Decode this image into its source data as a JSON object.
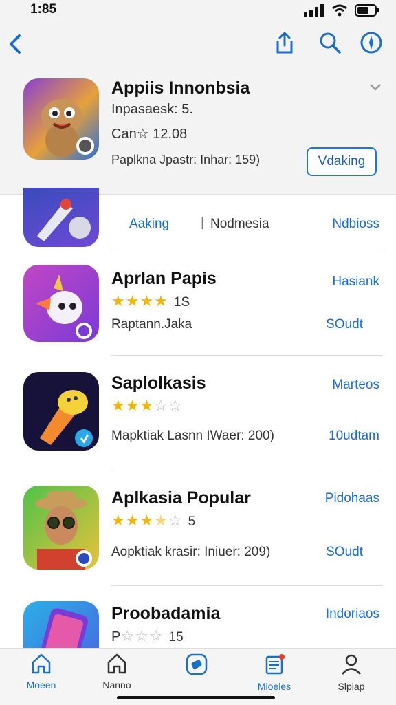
{
  "status_bar": {
    "time": "1:85"
  },
  "header": {
    "title": "Appiis Innonbsia",
    "line1": "Inpasaesk: 5.",
    "line2": "Can☆ 12.08",
    "line3": "Paplkna Jpastr: Inhar: 159)",
    "button": "Vdaking"
  },
  "partial_row": {
    "link_left": "Aaking",
    "separator": "|",
    "text_mid": "Nodmesia",
    "link_right": "Ndbioss"
  },
  "apps": [
    {
      "name": "Aprlan Papis",
      "rating_count": "1S",
      "subtitle": "Raptann.Jaka",
      "link_top": "Hasiank",
      "link_bottom": "SOudt",
      "stars_full": 4,
      "stars_empty": 0
    },
    {
      "name": "Saplolkasis",
      "rating_count": "",
      "subtitle": "Mapktiak Lasnn IWaer: 200)",
      "link_top": "Marteos",
      "link_bottom": "10udtam",
      "stars_full": 3,
      "stars_empty": 2
    },
    {
      "name": "Aplkasia Popular",
      "rating_count": "5",
      "subtitle": "Aopktiak krasir: Iniuer: 209)",
      "link_top": "Pidohaas",
      "link_bottom": "SOudt",
      "stars_full": 3.5,
      "stars_empty": 1
    },
    {
      "name": "Proobadamia",
      "rating_prefix": "P",
      "rating_count": "15",
      "subtitle": "",
      "link_top": "Indoriaos",
      "link_bottom": "",
      "stars_full": 0,
      "stars_empty": 3
    }
  ],
  "tabs": [
    {
      "label": "Moeen",
      "active": true
    },
    {
      "label": "Nanno",
      "active": false
    },
    {
      "label": "",
      "active": true
    },
    {
      "label": "Mioeles",
      "active": true
    },
    {
      "label": "Slpiap",
      "active": false
    }
  ],
  "colors": {
    "accent": "#1a6fc9",
    "star": "#f5b400"
  }
}
